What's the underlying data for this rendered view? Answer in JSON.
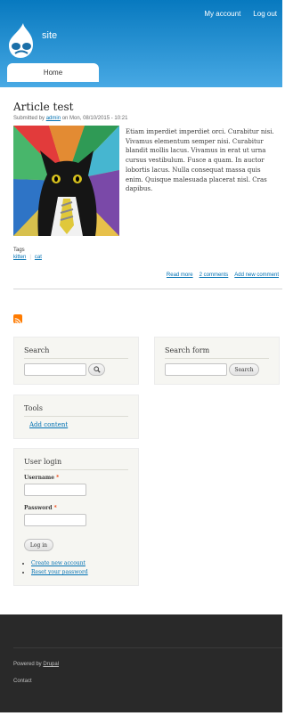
{
  "header": {
    "site_name": "site",
    "secondary_menu": [
      "My account",
      "Log out"
    ],
    "main_menu": [
      "Home"
    ]
  },
  "article": {
    "title": "Article test",
    "submitted_prefix": "Submitted by",
    "author": "admin",
    "submitted_suffix": "on Mon, 08/10/2015 - 10:21",
    "body": "Etiam imperdiet imperdiet orci. Curabitur nisi. Vivamus elementum semper nisi. Curabitur blandit mollis lacus. Vivamus in erat ut urna cursus vestibulum. Fusce a quam. In auctor lobortis lacus. Nulla consequat massa quis enim. Quisque malesuada placerat nisl. Cras dapibus.",
    "tags_label": "Tags",
    "tags": [
      "kitten",
      "cat"
    ],
    "links": [
      "Read more",
      "2 comments",
      "Add new comment"
    ]
  },
  "search_block": {
    "title": "Search",
    "button_icon": "search-icon"
  },
  "search_form_block": {
    "title": "Search form",
    "button_label": "Search"
  },
  "tools_block": {
    "title": "Tools",
    "link": "Add content"
  },
  "user_login": {
    "title": "User login",
    "username_label": "Username",
    "password_label": "Password",
    "required_mark": "*",
    "login_button": "Log in",
    "links": [
      "Create new account",
      "Reset your password"
    ]
  },
  "footer": {
    "powered_prefix": "Powered by",
    "powered_link": "Drupal",
    "contact": "Contact"
  },
  "colors": {
    "header_top": "#0779bf",
    "header_bottom": "#48a9e4",
    "link": "#0071b3",
    "footer_bg": "#292929",
    "rss": "#ff7b00"
  }
}
